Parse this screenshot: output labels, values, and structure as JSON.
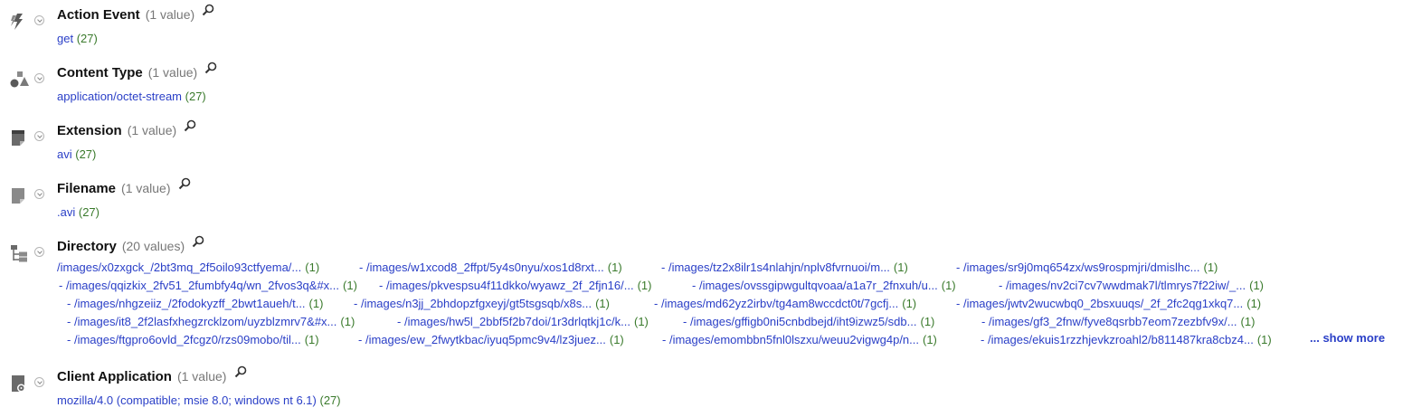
{
  "fields": [
    {
      "id": "action",
      "title": "Action Event",
      "count": "(1 value)",
      "icon": "lightning-icon",
      "values": [
        {
          "text": "get",
          "count": "(27)"
        }
      ]
    },
    {
      "id": "ctype",
      "title": "Content Type",
      "count": "(1 value)",
      "icon": "shapes-icon",
      "values": [
        {
          "text": "application/octet-stream",
          "count": "(27)"
        }
      ]
    },
    {
      "id": "ext",
      "title": "Extension",
      "count": "(1 value)",
      "icon": "document-icon",
      "values": [
        {
          "text": "avi",
          "count": "(27)"
        }
      ]
    },
    {
      "id": "fname",
      "title": "Filename",
      "count": "(1 value)",
      "icon": "file-icon",
      "values": [
        {
          "text": ".avi",
          "count": "(27)"
        }
      ]
    },
    {
      "id": "dir",
      "title": "Directory",
      "count": "(20 values)",
      "icon": "tree-icon",
      "rows": [
        [
          {
            "text": "/images/x0zxgck_/2bt3mq_2f5oilo93ctfyema/...",
            "count": "(1)"
          },
          {
            "text": "/images/w1xcod8_2ffpt/5y4s0nyu/xos1d8rxt...",
            "count": "(1)"
          },
          {
            "text": "/images/tz2x8ilr1s4nlahjn/nplv8fvrnuoi/m...",
            "count": "(1)"
          },
          {
            "text": "/images/sr9j0mq654zx/ws9rospmjri/dmislhc...",
            "count": "(1)"
          }
        ],
        [
          {
            "text": "/images/qqizkix_2fv51_2fumbfy4q/wn_2fvos3q&#x...",
            "count": "(1)"
          },
          {
            "text": "/images/pkvespsu4f11dkko/wyawz_2f_2fjn16/...",
            "count": "(1)"
          },
          {
            "text": "/images/ovssgipwgultqvoaa/a1a7r_2fnxuh/u...",
            "count": "(1)"
          },
          {
            "text": "/images/nv2ci7cv7wwdmak7l/tlmrys7f22iw/_...",
            "count": "(1)"
          }
        ],
        [
          {
            "text": "/images/nhgzeiiz_/2fodokyzff_2bwt1aueh/t...",
            "count": "(1)"
          },
          {
            "text": "/images/n3jj_2bhdopzfgxeyj/gt5tsgsqb/x8s...",
            "count": "(1)"
          },
          {
            "text": "/images/md62yz2irbv/tg4am8wccdct0t/7gcfj...",
            "count": "(1)"
          },
          {
            "text": "/images/jwtv2wucwbq0_2bsxuuqs/_2f_2fc2qg1xkq7...",
            "count": "(1)"
          }
        ],
        [
          {
            "text": "/images/it8_2f2lasfxhegzrcklzom/uyzblzmrv7&#x...",
            "count": "(1)"
          },
          {
            "text": "/images/hw5l_2bbf5f2b7doi/1r3drlqtkj1c/k...",
            "count": "(1)"
          },
          {
            "text": "/images/gffigb0ni5cnbdbejd/iht9izwz5/sdb...",
            "count": "(1)"
          },
          {
            "text": "/images/gf3_2fnw/fyve8qsrbb7eom7zezbfv9x/...",
            "count": "(1)"
          }
        ],
        [
          {
            "text": "/images/ftgpro6ovld_2fcgz0/rzs09mobo/til...",
            "count": "(1)"
          },
          {
            "text": "/images/ew_2fwytkbac/iyuq5pmc9v4/lz3juez...",
            "count": "(1)"
          },
          {
            "text": "/images/emombbn5fnl0lszxu/weuu2vigwg4p/n...",
            "count": "(1)"
          },
          {
            "text": "/images/ekuis1rzzhjevkzroahl2/b811487kra8cbz4...",
            "count": "(1)"
          }
        ]
      ],
      "show_more": "... show more"
    },
    {
      "id": "client",
      "title": "Client Application",
      "count": "(1 value)",
      "icon": "app-icon",
      "values": [
        {
          "text": "mozilla/4.0 (compatible; msie 8.0; windows nt 6.1)",
          "count": "(27)"
        }
      ]
    }
  ],
  "colors": {
    "link": "#2a3fc7",
    "count": "#3a7a2c",
    "muted": "#777777"
  }
}
